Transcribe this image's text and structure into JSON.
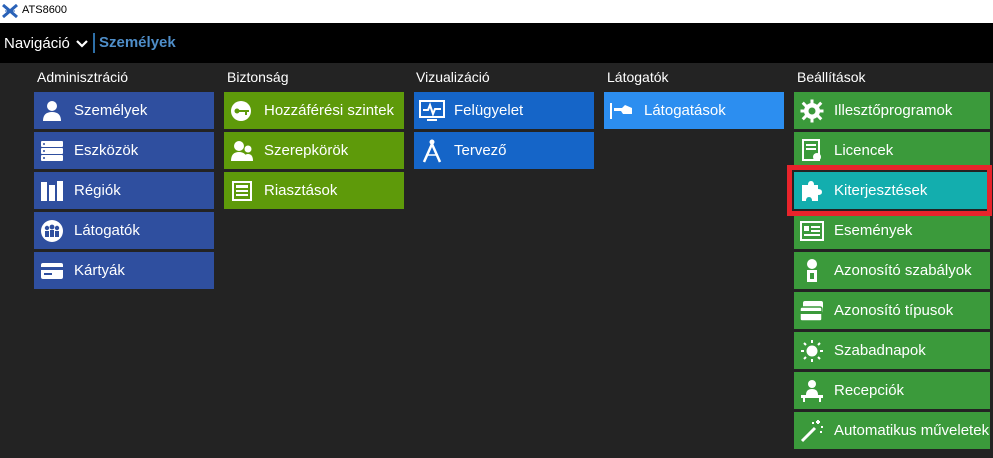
{
  "window": {
    "title": "ATS8600"
  },
  "nav": {
    "toggle_label": "Navigáció",
    "current": "Személyek"
  },
  "columns": [
    {
      "header": "Adminisztráció",
      "items": [
        {
          "label": "Személyek",
          "icon": "person-icon"
        },
        {
          "label": "Eszközök",
          "icon": "devices-icon"
        },
        {
          "label": "Régiók",
          "icon": "regions-icon"
        },
        {
          "label": "Látogatók",
          "icon": "visitors-group-icon"
        },
        {
          "label": "Kártyák",
          "icon": "card-icon"
        }
      ]
    },
    {
      "header": "Biztonság",
      "items": [
        {
          "label": "Hozzáférési szintek",
          "icon": "key-icon"
        },
        {
          "label": "Szerepkörök",
          "icon": "roles-icon"
        },
        {
          "label": "Riasztások",
          "icon": "alarms-icon"
        }
      ]
    },
    {
      "header": "Vizualizáció",
      "items": [
        {
          "label": "Felügyelet",
          "icon": "monitor-icon"
        },
        {
          "label": "Tervező",
          "icon": "compass-icon"
        }
      ]
    },
    {
      "header": "Látogatók",
      "items": [
        {
          "label": "Látogatások",
          "icon": "visit-icon"
        }
      ]
    },
    {
      "header": "Beállítások",
      "items": [
        {
          "label": "Illesztőprogramok",
          "icon": "gear-icon"
        },
        {
          "label": "Licencek",
          "icon": "license-icon"
        },
        {
          "label": "Kiterjesztések",
          "icon": "puzzle-icon"
        },
        {
          "label": "Események",
          "icon": "events-icon"
        },
        {
          "label": "Azonosító szabályok",
          "icon": "id-rules-icon"
        },
        {
          "label": "Azonosító típusok",
          "icon": "id-types-icon"
        },
        {
          "label": "Szabadnapok",
          "icon": "sun-icon"
        },
        {
          "label": "Recepciók",
          "icon": "reception-icon"
        },
        {
          "label": "Automatikus műveletek",
          "icon": "magic-wand-icon"
        }
      ]
    }
  ],
  "colors": {
    "admin": "#2f4f9f",
    "security": "#5e9a0a",
    "visualization": "#1565c8",
    "visitors": "#2c8ef0",
    "settings": "#3b9a3b",
    "settings_selected": "#13aeae",
    "highlight": "#e8242b",
    "nav_current": "#4f8ec9"
  }
}
